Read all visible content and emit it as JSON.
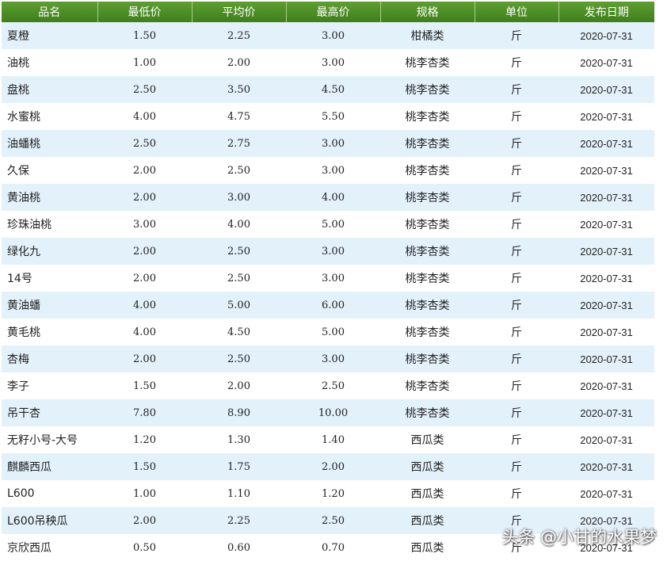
{
  "table": {
    "headers": [
      "品名",
      "最低价",
      "平均价",
      "最高价",
      "规格",
      "单位",
      "发布日期"
    ],
    "rows": [
      [
        "夏橙",
        "1.50",
        "2.25",
        "3.00",
        "柑橘类",
        "斤",
        "2020-07-31"
      ],
      [
        "油桃",
        "1.00",
        "2.00",
        "3.00",
        "桃李杏类",
        "斤",
        "2020-07-31"
      ],
      [
        "盘桃",
        "2.50",
        "3.50",
        "4.50",
        "桃李杏类",
        "斤",
        "2020-07-31"
      ],
      [
        "水蜜桃",
        "4.00",
        "4.75",
        "5.50",
        "桃李杏类",
        "斤",
        "2020-07-31"
      ],
      [
        "油蟠桃",
        "2.50",
        "2.75",
        "3.00",
        "桃李杏类",
        "斤",
        "2020-07-31"
      ],
      [
        "久保",
        "2.00",
        "2.50",
        "3.00",
        "桃李杏类",
        "斤",
        "2020-07-31"
      ],
      [
        "黄油桃",
        "2.00",
        "3.00",
        "4.00",
        "桃李杏类",
        "斤",
        "2020-07-31"
      ],
      [
        "珍珠油桃",
        "3.00",
        "4.00",
        "5.00",
        "桃李杏类",
        "斤",
        "2020-07-31"
      ],
      [
        "绿化九",
        "2.00",
        "2.50",
        "3.00",
        "桃李杏类",
        "斤",
        "2020-07-31"
      ],
      [
        "14号",
        "2.00",
        "2.50",
        "3.00",
        "桃李杏类",
        "斤",
        "2020-07-31"
      ],
      [
        "黄油蟠",
        "4.00",
        "5.00",
        "6.00",
        "桃李杏类",
        "斤",
        "2020-07-31"
      ],
      [
        "黄毛桃",
        "4.00",
        "4.50",
        "5.00",
        "桃李杏类",
        "斤",
        "2020-07-31"
      ],
      [
        "杏梅",
        "2.00",
        "2.50",
        "3.00",
        "桃李杏类",
        "斤",
        "2020-07-31"
      ],
      [
        "李子",
        "1.50",
        "2.00",
        "2.50",
        "桃李杏类",
        "斤",
        "2020-07-31"
      ],
      [
        "吊干杏",
        "7.80",
        "8.90",
        "10.00",
        "桃李杏类",
        "斤",
        "2020-07-31"
      ],
      [
        "无籽小号-大号",
        "1.20",
        "1.30",
        "1.40",
        "西瓜类",
        "斤",
        "2020-07-31"
      ],
      [
        "麒麟西瓜",
        "1.50",
        "1.75",
        "2.00",
        "西瓜类",
        "斤",
        "2020-07-31"
      ],
      [
        "L600",
        "1.00",
        "1.10",
        "1.20",
        "西瓜类",
        "斤",
        "2020-07-31"
      ],
      [
        "L600吊秧瓜",
        "2.00",
        "2.25",
        "2.50",
        "西瓜类",
        "斤",
        "2020-07-31"
      ],
      [
        "京欣西瓜",
        "0.50",
        "0.60",
        "0.70",
        "西瓜类",
        "斤",
        "2020-07-31"
      ]
    ]
  },
  "watermark": "头条 @小甘的水果梦",
  "colors": {
    "header_bg": "#4e8e26",
    "header_text": "#ffffff",
    "row_odd_bg": "#e3f1fb",
    "row_even_bg": "#ffffff"
  }
}
